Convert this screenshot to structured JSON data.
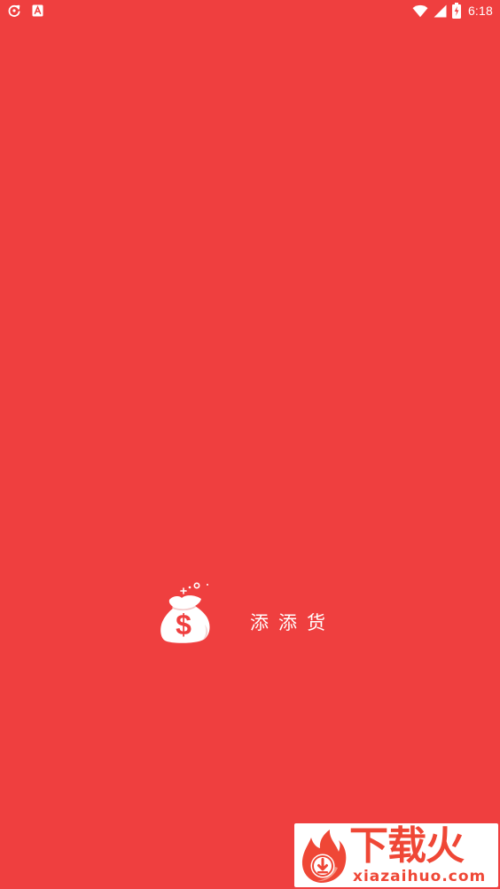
{
  "status_bar": {
    "time": "6:18",
    "left_icons": [
      "refresh-icon",
      "keyboard-a-icon"
    ],
    "right_icons": [
      "wifi-icon",
      "cell-signal-icon",
      "battery-charging-icon"
    ]
  },
  "splash": {
    "logo_icon": "money-bag-dollar-icon",
    "app_name": "添添货"
  },
  "watermark": {
    "logo_icon": "flame-download-icon",
    "name": "下载火",
    "url": "xiazaihuo.com"
  },
  "colors": {
    "background": "#ef3f3f",
    "foreground": "#ffffff",
    "watermark_red": "#ef4736"
  }
}
